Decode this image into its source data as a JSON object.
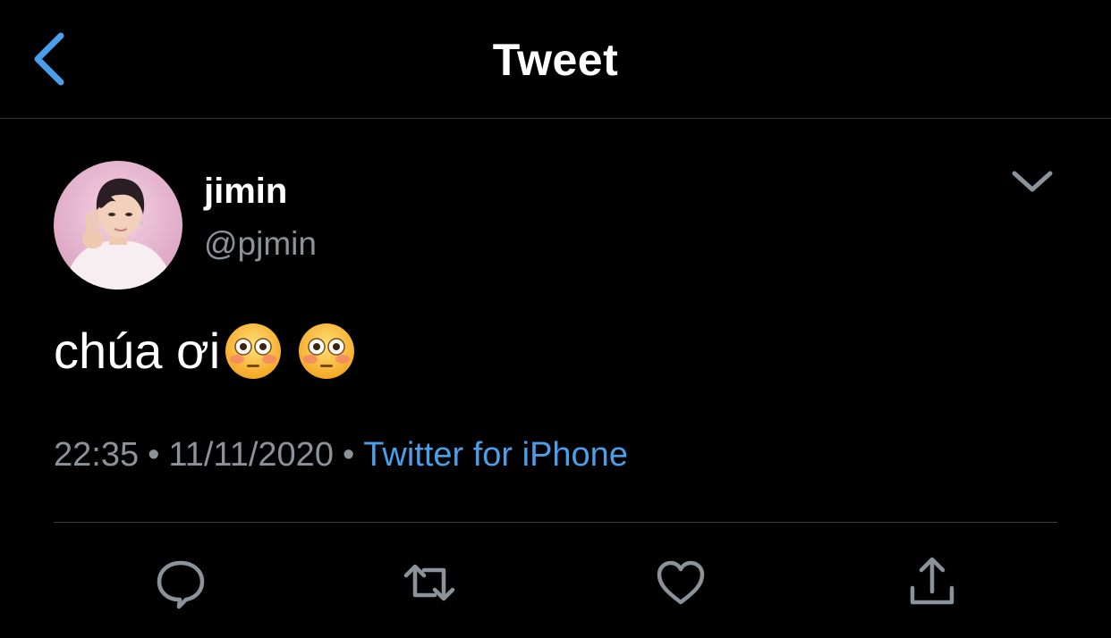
{
  "nav": {
    "title": "Tweet",
    "back_icon": "chevron-left-icon"
  },
  "tweet": {
    "author": {
      "display_name": "jimin",
      "handle": "@pjmin"
    },
    "text": "chúa ơi",
    "emojis": [
      "flushed-face-emoji",
      "flushed-face-emoji"
    ],
    "time": "22:35",
    "separator": "•",
    "date": "11/11/2020",
    "source": "Twitter for iPhone"
  },
  "actions": [
    "reply-icon",
    "retweet-icon",
    "like-icon",
    "share-icon"
  ],
  "colors": {
    "background": "#000000",
    "accent": "#4b9fe8",
    "secondary_text": "#8b9299",
    "divider": "#3a3f44",
    "icon": "#8b9299"
  }
}
